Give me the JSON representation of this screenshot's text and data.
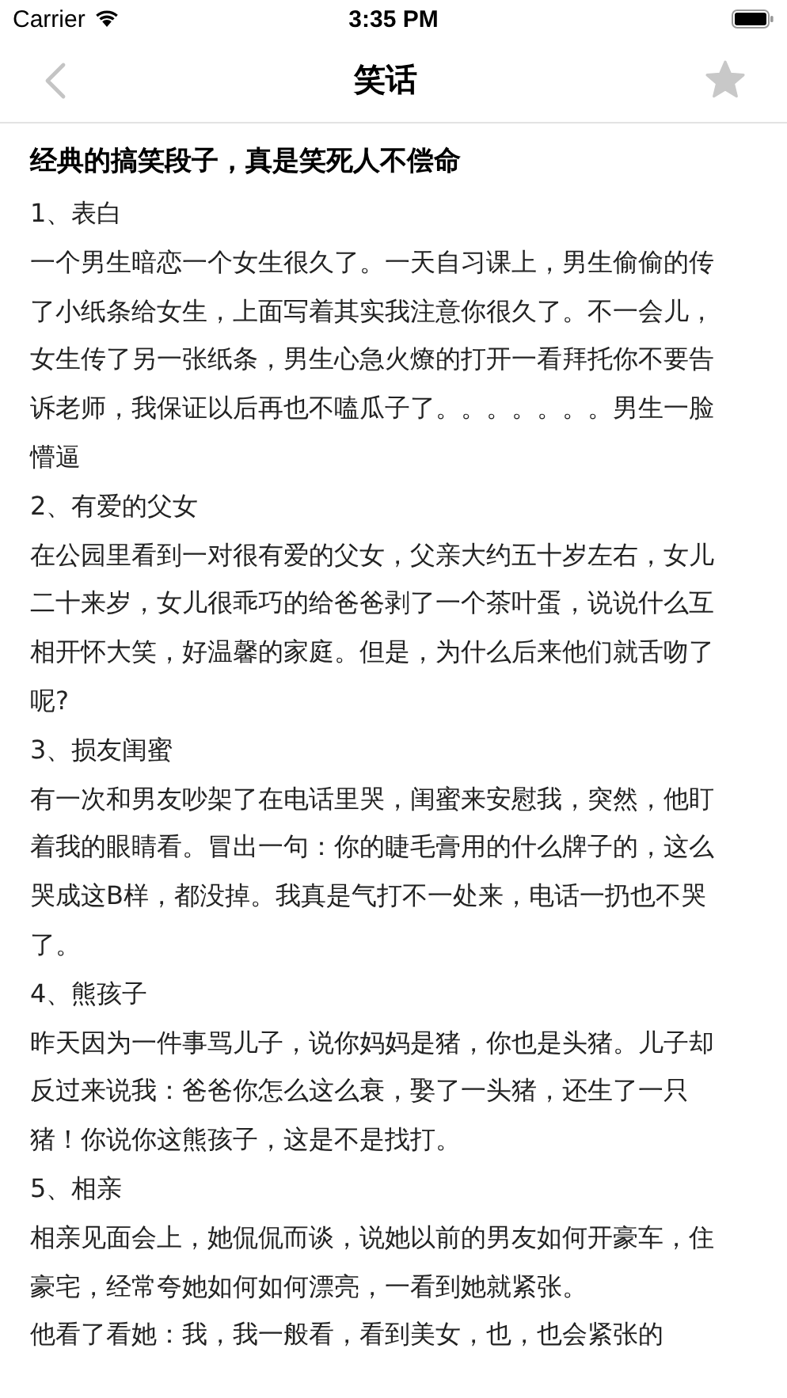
{
  "status_bar": {
    "carrier": "Carrier",
    "time": "3:35 PM"
  },
  "nav": {
    "title": "笑话"
  },
  "article": {
    "heading": "经典的搞笑段子，真是笑死人不偿命",
    "sections": [
      {
        "title": "1、表白",
        "paragraphs": [
          "一个男生暗恋一个女生很久了。一天自习课上，男生偷偷的传了小纸条给女生，上面写着其实我注意你很久了。不一会儿，女生传了另一张纸条，男生心急火燎的打开一看拜托你不要告诉老师，我保证以后再也不嗑瓜子了。。。。。。。男生一脸懵逼"
        ]
      },
      {
        "title": "2、有爱的父女",
        "paragraphs": [
          "在公园里看到一对很有爱的父女，父亲大约五十岁左右，女儿二十来岁，女儿很乖巧的给爸爸剥了一个茶叶蛋，说说什么互相开怀大笑，好温馨的家庭。但是，为什么后来他们就舌吻了呢?"
        ]
      },
      {
        "title": "3、损友闺蜜",
        "paragraphs": [
          "有一次和男友吵架了在电话里哭，闺蜜来安慰我，突然，他盯着我的眼睛看。冒出一句：你的睫毛膏用的什么牌子的，这么哭成这B样，都没掉。我真是气打不一处来，电话一扔也不哭了。"
        ]
      },
      {
        "title": "4、熊孩子",
        "paragraphs": [
          "昨天因为一件事骂儿子，说你妈妈是猪，你也是头猪。儿子却反过来说我：爸爸你怎么这么衰，娶了一头猪，还生了一只猪！你说你这熊孩子，这是不是找打。"
        ]
      },
      {
        "title": "5、相亲",
        "paragraphs": [
          "相亲见面会上，她侃侃而谈，说她以前的男友如何开豪车，住豪宅，经常夸她如何如何漂亮，一看到她就紧张。",
          "他看了看她：我，我一般看，看到美女，也，也会紧张的"
        ]
      }
    ]
  }
}
